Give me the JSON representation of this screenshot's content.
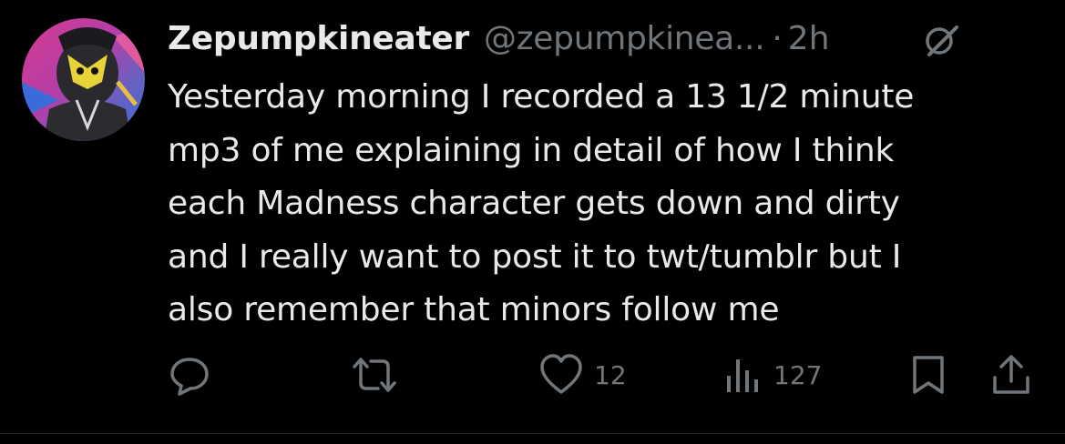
{
  "tweet": {
    "author": {
      "display_name": "Zepumpkineater",
      "handle": "@zepumpkinea...",
      "avatar": "avatar-image"
    },
    "separator": "·",
    "time": "2h",
    "text": "Yesterday morning I recorded a 13 1/2 minute\nmp3 of me explaining in detail of how I think\neach Madness character gets down and dirty\nand I really want to post it to twt/tumblr but I\nalso remember that minors follow me",
    "header_icon": "grok-icon"
  },
  "actions": {
    "reply": {
      "icon": "reply-icon"
    },
    "retweet": {
      "icon": "retweet-icon"
    },
    "like": {
      "icon": "heart-icon",
      "count": "12"
    },
    "views": {
      "icon": "views-icon",
      "count": "127"
    },
    "bookmark": {
      "icon": "bookmark-icon"
    },
    "share": {
      "icon": "share-icon"
    }
  },
  "colors": {
    "background": "#000000",
    "primary_text": "#e7e9ea",
    "secondary_text": "#71767b"
  }
}
